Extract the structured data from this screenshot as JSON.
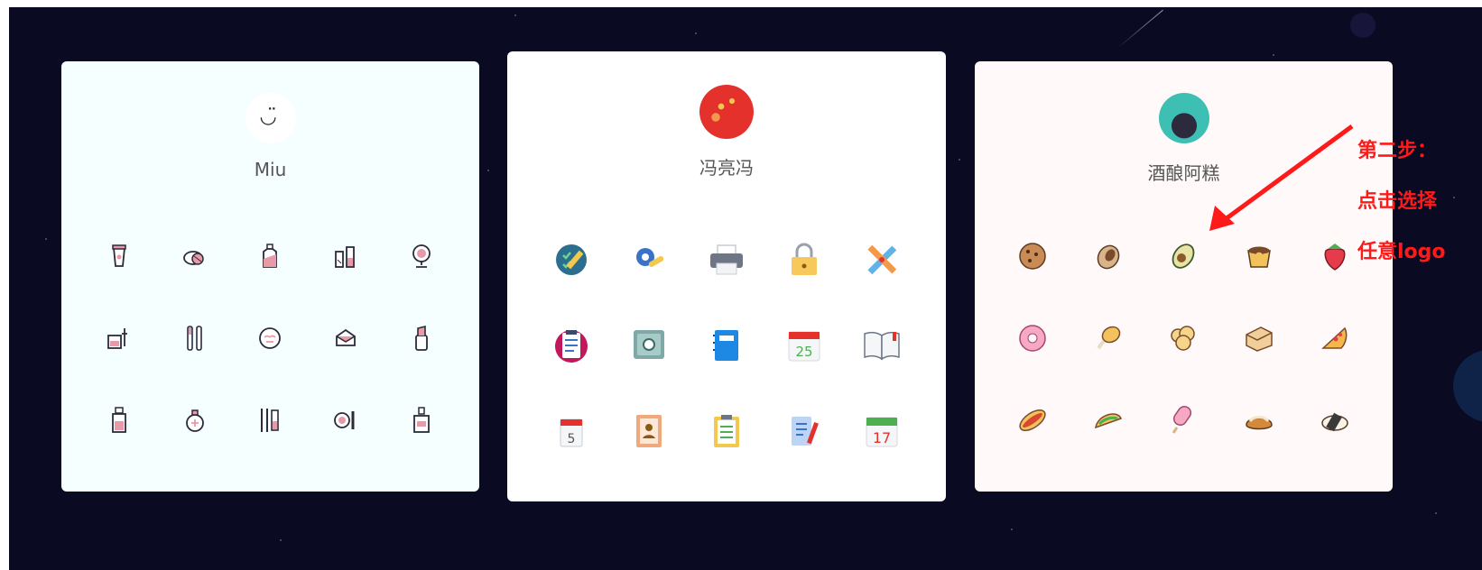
{
  "cards": [
    {
      "name": "Miu",
      "avatar_icon": "smiley-face",
      "icons": [
        "cosmetic-cup",
        "compact-powder",
        "lotion-bottle",
        "brushes-tube",
        "hand-mirror",
        "dropper-bottle",
        "makeup-brushes",
        "face-mask",
        "eyeshadow-palette",
        "lipstick",
        "serum-bottle",
        "perfume-atomizer",
        "tweezers",
        "compact-and-brush",
        "cologne-bottle"
      ],
      "icon_color": "#c0445a"
    },
    {
      "name": "冯亮冯",
      "avatar_icon": "red-abstract-avatar",
      "icons": [
        "checklist-badge",
        "gear-wrench",
        "printer",
        "padlock",
        "pencil-ruler-cross",
        "clipboard-list",
        "safe-box",
        "notebook",
        "calendar-25",
        "open-book",
        "calendar-5",
        "address-book",
        "clipboard-checklist",
        "notepad-pen",
        "calendar-17"
      ],
      "calendar_numbers": [
        "25",
        "5",
        "17"
      ]
    },
    {
      "name": "酒酿阿糕",
      "avatar_icon": "black-cat-avatar",
      "icons": [
        "cookie",
        "nut",
        "avocado",
        "pudding",
        "strawberry",
        "donut",
        "chicken-leg",
        "popcorn",
        "bread-loaf",
        "pizza-slice",
        "hotdog",
        "taco",
        "popsicle",
        "cream-puff",
        "sushi"
      ]
    }
  ],
  "annotation": {
    "lines": [
      "第二步：",
      "点击选择",
      "任意logo"
    ],
    "color": "#ff1a1a"
  }
}
